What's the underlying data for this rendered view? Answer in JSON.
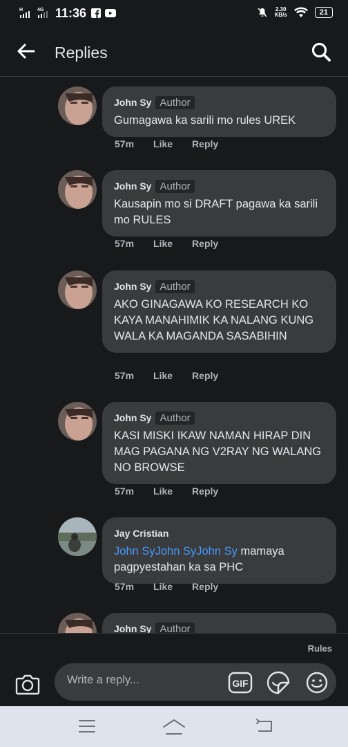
{
  "status_bar": {
    "network_h": "H",
    "network_4g": "4G",
    "time": "11:36",
    "speed_value": "2.30",
    "speed_unit": "KB/s",
    "battery": "21"
  },
  "header": {
    "title": "Replies",
    "back_icon": "arrow-left-icon",
    "search_icon": "search-icon"
  },
  "comments": [
    {
      "name": "John Sy",
      "badge": "Author",
      "text": "Gumagawa ka sarili mo rules UREK",
      "time": "57m",
      "like": "Like",
      "reply": "Reply"
    },
    {
      "name": "John Sy",
      "badge": "Author",
      "text": "Kausapin mo si DRAFT pagawa ka sarili mo RULES",
      "time": "57m",
      "like": "Like",
      "reply": "Reply"
    },
    {
      "name": "John Sy",
      "badge": "Author",
      "text": "AKO GINAGAWA KO RESEARCH KO KAYA MANAHIMIK KA NALANG KUNG WALA KA MAGANDA SASABIHIN",
      "time": "57m",
      "like": "Like",
      "reply": "Reply"
    },
    {
      "name": "John Sy",
      "badge": "Author",
      "text": "KASI MISKI IKAW NAMAN HIRAP DIN MAG PAGANA NG V2RAY NG WALANG NO BROWSE",
      "time": "57m",
      "like": "Like",
      "reply": "Reply"
    },
    {
      "name": "Jay Cristian",
      "mention": "John SyJohn SyJohn Sy",
      "text": " mamaya pagpyestahan ka sa PHC",
      "time": "57m",
      "like": "Like",
      "reply": "Reply"
    },
    {
      "name": "John Sy",
      "badge": "Author"
    }
  ],
  "composer": {
    "rules_label": "Rules",
    "placeholder": "Write a reply...",
    "gif_label": "GIF",
    "camera_icon": "camera-icon",
    "sticker_icon": "sticker-icon",
    "emoji_icon": "emoji-icon"
  },
  "colors": {
    "background": "#18191a",
    "bubble": "#3a3b3c",
    "mention": "#4599ff",
    "secondary_text": "#b0b3b8"
  }
}
